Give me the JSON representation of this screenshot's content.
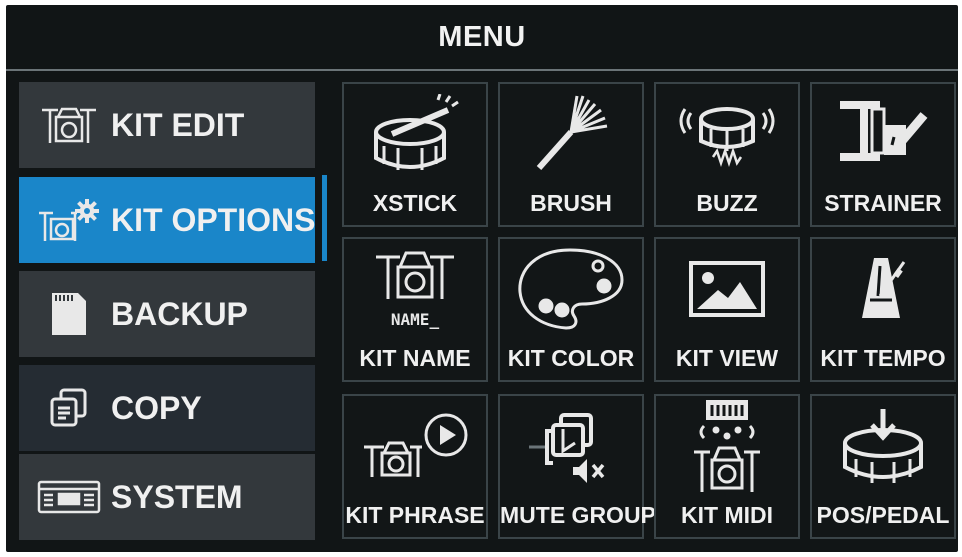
{
  "title": "MENU",
  "colors": {
    "accent": "#1a86c9",
    "background": "#111516",
    "tile_border": "#3a4448",
    "text": "#f0f0f0"
  },
  "sidebar": {
    "items": [
      {
        "label": "KIT EDIT",
        "icon": "drum-kit-icon"
      },
      {
        "label": "KIT OPTIONS",
        "icon": "drum-kit-gear-icon",
        "active": true
      },
      {
        "label": "BACKUP",
        "icon": "sd-card-icon"
      },
      {
        "label": "COPY",
        "icon": "copy-icon"
      },
      {
        "label": "SYSTEM",
        "icon": "module-icon"
      }
    ]
  },
  "grid": {
    "tiles": [
      {
        "label": "XSTICK",
        "icon": "snare-stick-icon"
      },
      {
        "label": "BRUSH",
        "icon": "brush-icon"
      },
      {
        "label": "BUZZ",
        "icon": "buzz-snare-icon"
      },
      {
        "label": "STRAINER",
        "icon": "strainer-icon"
      },
      {
        "label": "KIT NAME",
        "icon": "kit-name-icon",
        "icon_text": "NAME_"
      },
      {
        "label": "KIT COLOR",
        "icon": "palette-icon"
      },
      {
        "label": "KIT VIEW",
        "icon": "image-icon"
      },
      {
        "label": "KIT TEMPO",
        "icon": "metronome-icon"
      },
      {
        "label": "KIT PHRASE",
        "icon": "kit-play-icon"
      },
      {
        "label": "MUTE GROUP",
        "icon": "mute-group-icon"
      },
      {
        "label": "KIT MIDI",
        "icon": "kit-midi-icon"
      },
      {
        "label": "POS/PEDAL",
        "icon": "snare-down-arrow-icon"
      }
    ]
  }
}
